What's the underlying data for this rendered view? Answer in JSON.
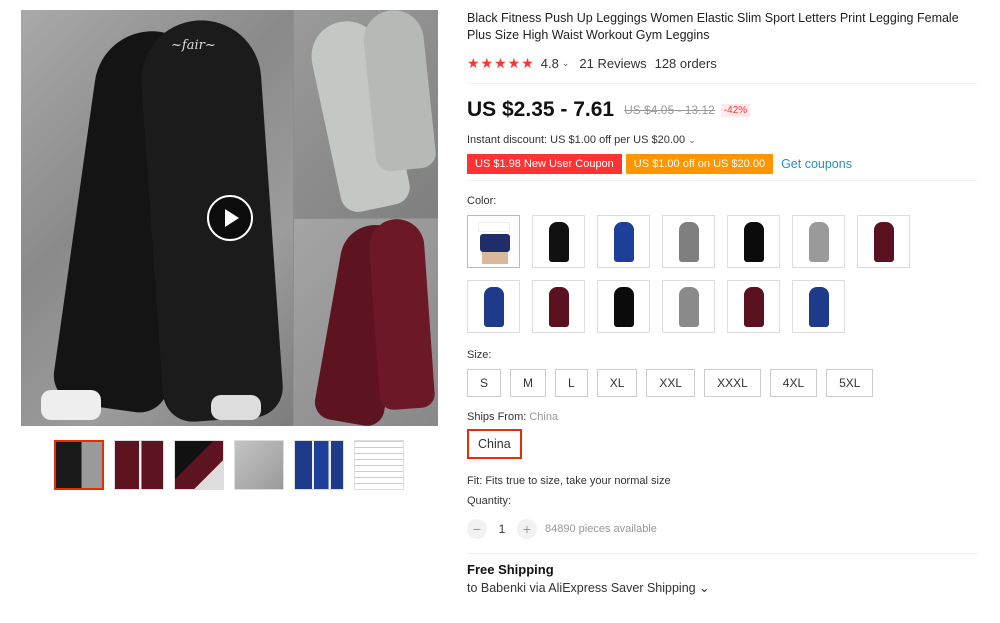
{
  "product": {
    "title": "Black Fitness Push Up Leggings Women Elastic Slim Sport Letters Print Legging Female Plus Size High Waist Workout Gym Leggins",
    "stars": "★★★★★",
    "rating": "4.8",
    "reviews": "21 Reviews",
    "orders": "128 orders",
    "price": "US $2.35 - 7.61",
    "original_price": "US $4.05 - 13.12",
    "discount": "-42%",
    "instant_discount": "Instant discount: US $1.00 off per US $20.00",
    "coupon_new_user": "US $1.98 New User Coupon",
    "coupon_off": "US $1.00 off on US $20.00",
    "get_coupons": "Get coupons"
  },
  "color": {
    "label": "Color:",
    "swatches": [
      "#1f2d6b",
      "#111111",
      "#1d3f9a",
      "#7f7f7f",
      "#0b0b0b",
      "#9a9a9a",
      "#5a1220",
      "#1e3a8a",
      "#5a1220",
      "#0b0b0b",
      "#8a8a8a",
      "#5a1220",
      "#1e3a8a"
    ]
  },
  "size": {
    "label": "Size:",
    "options": [
      "S",
      "M",
      "L",
      "XL",
      "XXL",
      "XXXL",
      "4XL",
      "5XL"
    ]
  },
  "ships": {
    "label": "Ships From:",
    "value": "China",
    "button": "China"
  },
  "fit": "Fit: Fits true to size, take your normal size",
  "quantity": {
    "label": "Quantity:",
    "minus": "−",
    "value": "1",
    "plus": "+",
    "available": "84890 pieces available"
  },
  "shipping": {
    "title": "Free Shipping",
    "detail": "to Babenki via AliExpress Saver Shipping ⌄"
  },
  "icons": {
    "rating_dropdown": "chevron-down-icon",
    "discount_dropdown": "chevron-down-icon",
    "play": "play-icon"
  },
  "colors": {
    "accent": "#e62e04",
    "star": "#ff3333",
    "coupon_red": "#ff3333",
    "coupon_orange": "#ff9500",
    "link": "#2a8fbd"
  }
}
